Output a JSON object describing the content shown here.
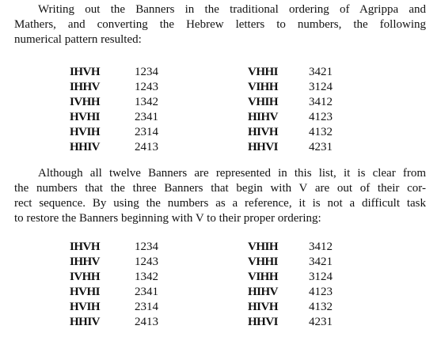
{
  "paragraph1": {
    "lines": [
      "Writing out the Banners in the traditional ordering of Agrippa and",
      "Mathers, and converting the Hebrew letters to numbers, the following",
      "numerical pattern resulted:"
    ]
  },
  "table1": {
    "rows": [
      {
        "left_banner": "IHVH",
        "left_number": "1234",
        "right_banner": "VHHI",
        "right_number": "3421"
      },
      {
        "left_banner": "IHHV",
        "left_number": "1243",
        "right_banner": "VIHH",
        "right_number": "3124"
      },
      {
        "left_banner": "IVHH",
        "left_number": "1342",
        "right_banner": "VHIH",
        "right_number": "3412"
      },
      {
        "left_banner": "HVHI",
        "left_number": "2341",
        "right_banner": "HIHV",
        "right_number": "4123"
      },
      {
        "left_banner": "HVIH",
        "left_number": "2314",
        "right_banner": "HIVH",
        "right_number": "4132"
      },
      {
        "left_banner": "HHIV",
        "left_number": "2413",
        "right_banner": "HHVI",
        "right_number": "4231"
      }
    ]
  },
  "paragraph2": {
    "lines": [
      "Although all twelve Banners are represented in this list, it is clear from",
      "the numbers that the three Banners that begin with V are out of their cor-",
      "rect sequence. By using the numbers as a reference, it is not a difficult task",
      "to restore the Banners beginning with V to their proper ordering:"
    ]
  },
  "table2": {
    "rows": [
      {
        "left_banner": "IHVH",
        "left_number": "1234",
        "right_banner": "VHIH",
        "right_number": "3412"
      },
      {
        "left_banner": "IHHV",
        "left_number": "1243",
        "right_banner": "VHHI",
        "right_number": "3421"
      },
      {
        "left_banner": "IVHH",
        "left_number": "1342",
        "right_banner": "VIHH",
        "right_number": "3124"
      },
      {
        "left_banner": "HVHI",
        "left_number": "2341",
        "right_banner": "HIHV",
        "right_number": "4123"
      },
      {
        "left_banner": "HVIH",
        "left_number": "2314",
        "right_banner": "HIVH",
        "right_number": "4132"
      },
      {
        "left_banner": "HHIV",
        "left_number": "2413",
        "right_banner": "HHVI",
        "right_number": "4231"
      }
    ]
  }
}
